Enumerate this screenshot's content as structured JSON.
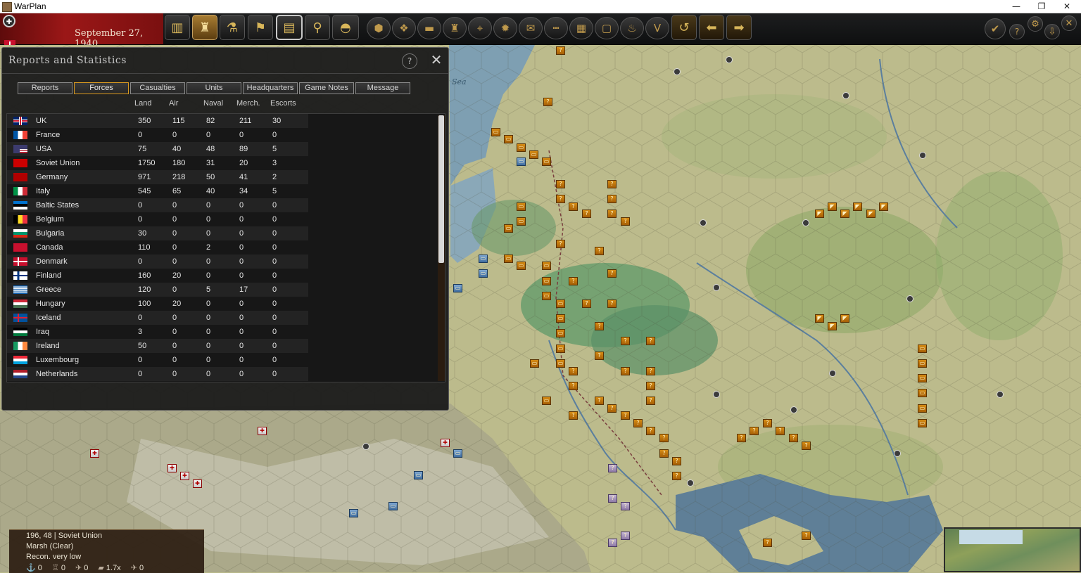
{
  "window": {
    "title": "WarPlan",
    "minimize": "—",
    "restore": "❐",
    "close": "✕"
  },
  "toolbar": {
    "date": "September 27, 1940",
    "buttons_left": [
      "factory-icon",
      "infantry-icon",
      "research-icon",
      "flag-icon",
      "reports-icon",
      "binoculars-icon",
      "helmet-icon"
    ],
    "buttons_mid": [
      "hex-icon",
      "hexes-icon",
      "tank-icon",
      "artillery-icon",
      "target-icon",
      "supply-icon",
      "envelope-icon",
      "rail-icon",
      "grid-icon",
      "frame-icon",
      "fire-icon",
      "victory-icon",
      "undo-icon",
      "back-arrow-icon",
      "forward-arrow-icon"
    ],
    "buttons_right": [
      "check-icon",
      "help-icon",
      "settings-icon",
      "download-icon",
      "close-icon"
    ],
    "glyphs": {
      "factory": "▥",
      "infantry": "♜",
      "research": "⚗",
      "flag": "⚑",
      "reports": "▤",
      "binoculars": "⚲",
      "helmet": "◓",
      "hex": "⬢",
      "hexes": "❖",
      "tank": "▬",
      "artillery": "♜",
      "target": "⌖",
      "supply": "✹",
      "envelope": "✉",
      "rail": "┅",
      "grid": "▦",
      "frame": "▢",
      "fire": "♨",
      "victory": "V",
      "undo": "↺",
      "back": "⬅",
      "forward": "➡",
      "check": "✔",
      "help": "?",
      "settings": "⚙",
      "download": "⇩",
      "close": "✕"
    }
  },
  "map": {
    "sea_label": "Sea"
  },
  "dialog": {
    "title": "Reports and Statistics",
    "help": "?",
    "close": "✕",
    "tabs": [
      "Reports",
      "Forces",
      "Casualties",
      "Units",
      "Headquarters",
      "Game Notes",
      "Message"
    ],
    "selected_tab": "Forces",
    "columns": [
      "Land",
      "Air",
      "Naval",
      "Merch.",
      "Escorts"
    ],
    "rows": [
      {
        "name": "UK",
        "land": "350",
        "air": "115",
        "naval": "82",
        "merch": "211",
        "escorts": "30",
        "flag": "uk"
      },
      {
        "name": "France",
        "land": "0",
        "air": "0",
        "naval": "0",
        "merch": "0",
        "escorts": "0",
        "flag": "france"
      },
      {
        "name": "USA",
        "land": "75",
        "air": "40",
        "naval": "48",
        "merch": "89",
        "escorts": "5",
        "flag": "usa"
      },
      {
        "name": "Soviet Union",
        "land": "1750",
        "air": "180",
        "naval": "31",
        "merch": "20",
        "escorts": "3",
        "flag": "soviet"
      },
      {
        "name": "Germany",
        "land": "971",
        "air": "218",
        "naval": "50",
        "merch": "41",
        "escorts": "2",
        "flag": "germany"
      },
      {
        "name": "Italy",
        "land": "545",
        "air": "65",
        "naval": "40",
        "merch": "34",
        "escorts": "5",
        "flag": "italy"
      },
      {
        "name": "Baltic States",
        "land": "0",
        "air": "0",
        "naval": "0",
        "merch": "0",
        "escorts": "0",
        "flag": "baltic"
      },
      {
        "name": "Belgium",
        "land": "0",
        "air": "0",
        "naval": "0",
        "merch": "0",
        "escorts": "0",
        "flag": "belgium"
      },
      {
        "name": "Bulgaria",
        "land": "30",
        "air": "0",
        "naval": "0",
        "merch": "0",
        "escorts": "0",
        "flag": "bulgaria"
      },
      {
        "name": "Canada",
        "land": "110",
        "air": "0",
        "naval": "2",
        "merch": "0",
        "escorts": "0",
        "flag": "canada"
      },
      {
        "name": "Denmark",
        "land": "0",
        "air": "0",
        "naval": "0",
        "merch": "0",
        "escorts": "0",
        "flag": "denmark"
      },
      {
        "name": "Finland",
        "land": "160",
        "air": "20",
        "naval": "0",
        "merch": "0",
        "escorts": "0",
        "flag": "finland"
      },
      {
        "name": "Greece",
        "land": "120",
        "air": "0",
        "naval": "5",
        "merch": "17",
        "escorts": "0",
        "flag": "greece"
      },
      {
        "name": "Hungary",
        "land": "100",
        "air": "20",
        "naval": "0",
        "merch": "0",
        "escorts": "0",
        "flag": "hungary"
      },
      {
        "name": "Iceland",
        "land": "0",
        "air": "0",
        "naval": "0",
        "merch": "0",
        "escorts": "0",
        "flag": "iceland"
      },
      {
        "name": "Iraq",
        "land": "3",
        "air": "0",
        "naval": "0",
        "merch": "0",
        "escorts": "0",
        "flag": "iraq"
      },
      {
        "name": "Ireland",
        "land": "50",
        "air": "0",
        "naval": "0",
        "merch": "0",
        "escorts": "0",
        "flag": "ireland"
      },
      {
        "name": "Luxembourg",
        "land": "0",
        "air": "0",
        "naval": "0",
        "merch": "0",
        "escorts": "0",
        "flag": "luxembourg"
      },
      {
        "name": "Netherlands",
        "land": "0",
        "air": "0",
        "naval": "0",
        "merch": "0",
        "escorts": "0",
        "flag": "netherlands"
      }
    ]
  },
  "info": {
    "coords": "196, 48",
    "country": "Soviet Union",
    "terrain": "Marsh (Clear)",
    "recon": "Recon. very low",
    "stats": [
      {
        "icon": "anchor-icon",
        "glyph": "⚓",
        "value": "0"
      },
      {
        "icon": "fort-icon",
        "glyph": "♖",
        "value": "0"
      },
      {
        "icon": "plane-icon",
        "glyph": "✈",
        "value": "0"
      },
      {
        "icon": "terrain-icon",
        "glyph": "▰",
        "value": "1.7x"
      },
      {
        "icon": "supply-plane-icon",
        "glyph": "✈",
        "value": "0"
      }
    ]
  },
  "colors": {
    "accent": "#d99a20",
    "datebar": "#9b1717",
    "unit_orange": "#d68c14",
    "soviet_red": "#c8102e"
  }
}
